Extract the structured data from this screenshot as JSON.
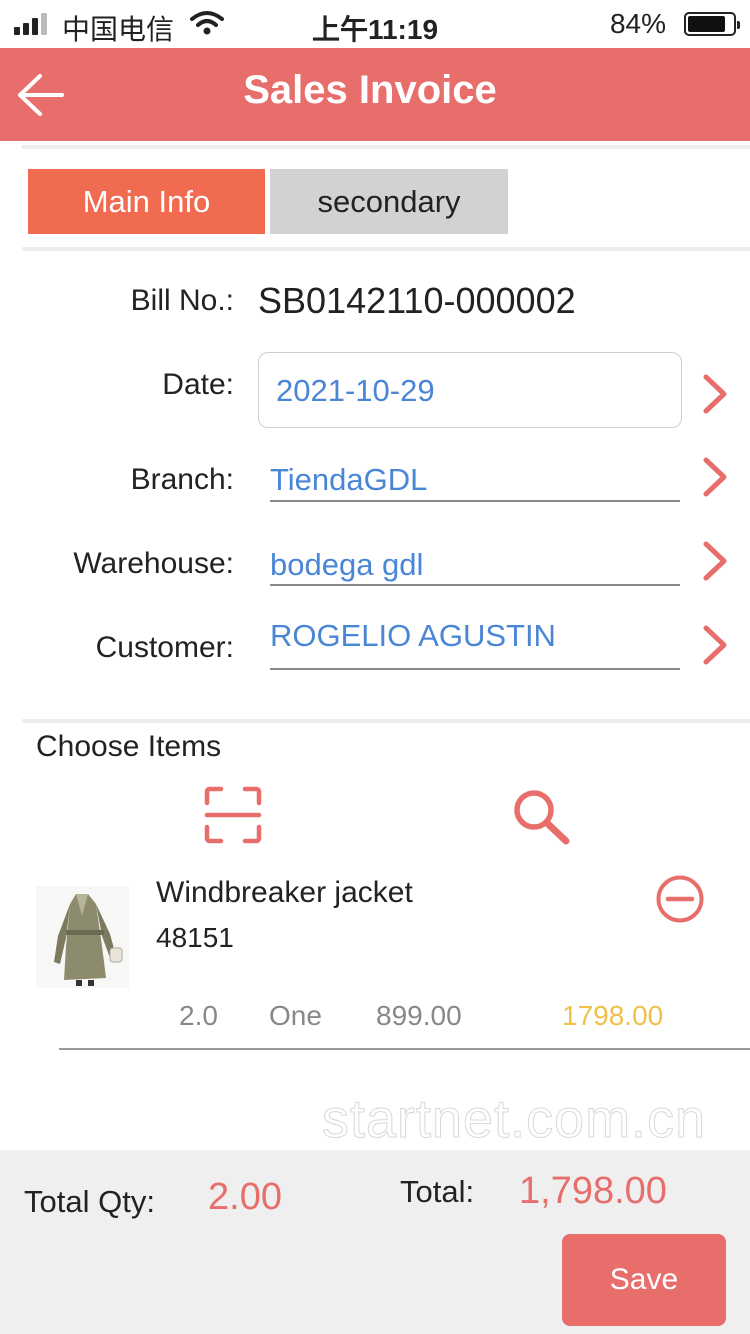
{
  "status_bar": {
    "carrier": "中国电信",
    "time": "上午11:19",
    "battery_pct": "84%",
    "battery_level": 0.84,
    "signal_bars": 3,
    "icons": [
      "signal-icon",
      "wifi-icon",
      "battery-icon"
    ]
  },
  "navbar": {
    "title": "Sales Invoice",
    "back_icon": "back-arrow-icon"
  },
  "tabs": [
    {
      "label": "Main Info",
      "active": true
    },
    {
      "label": "secondary",
      "active": false
    }
  ],
  "form": {
    "bill_no_label": "Bill No.:",
    "bill_no": "SB0142110-000002",
    "date_label": "Date:",
    "date": "2021-10-29",
    "branch_label": "Branch:",
    "branch": "TiendaGDL",
    "warehouse_label": "Warehouse:",
    "warehouse": "bodega gdl",
    "customer_label": "Customer:",
    "customer": "ROGELIO AGUSTIN"
  },
  "items_section": {
    "title": "Choose Items",
    "icons": [
      "scan-icon",
      "search-icon"
    ],
    "items": [
      {
        "name": "Windbreaker jacket",
        "code": "48151",
        "qty": "2.0",
        "unit": "One",
        "price": "899.00",
        "amount": "1798.00"
      }
    ]
  },
  "watermark": "startnet.com.cn",
  "footer": {
    "total_qty_label": "Total Qty:",
    "total_qty": "2.00",
    "total_label": "Total:",
    "total": "1,798.00",
    "save_label": "Save"
  },
  "colors": {
    "accent": "#e86e6c",
    "tab_active": "#f06b50",
    "tab_inactive": "#d2d2d2",
    "link_blue": "#4a86d6",
    "amount_yellow": "#f0c04a"
  }
}
